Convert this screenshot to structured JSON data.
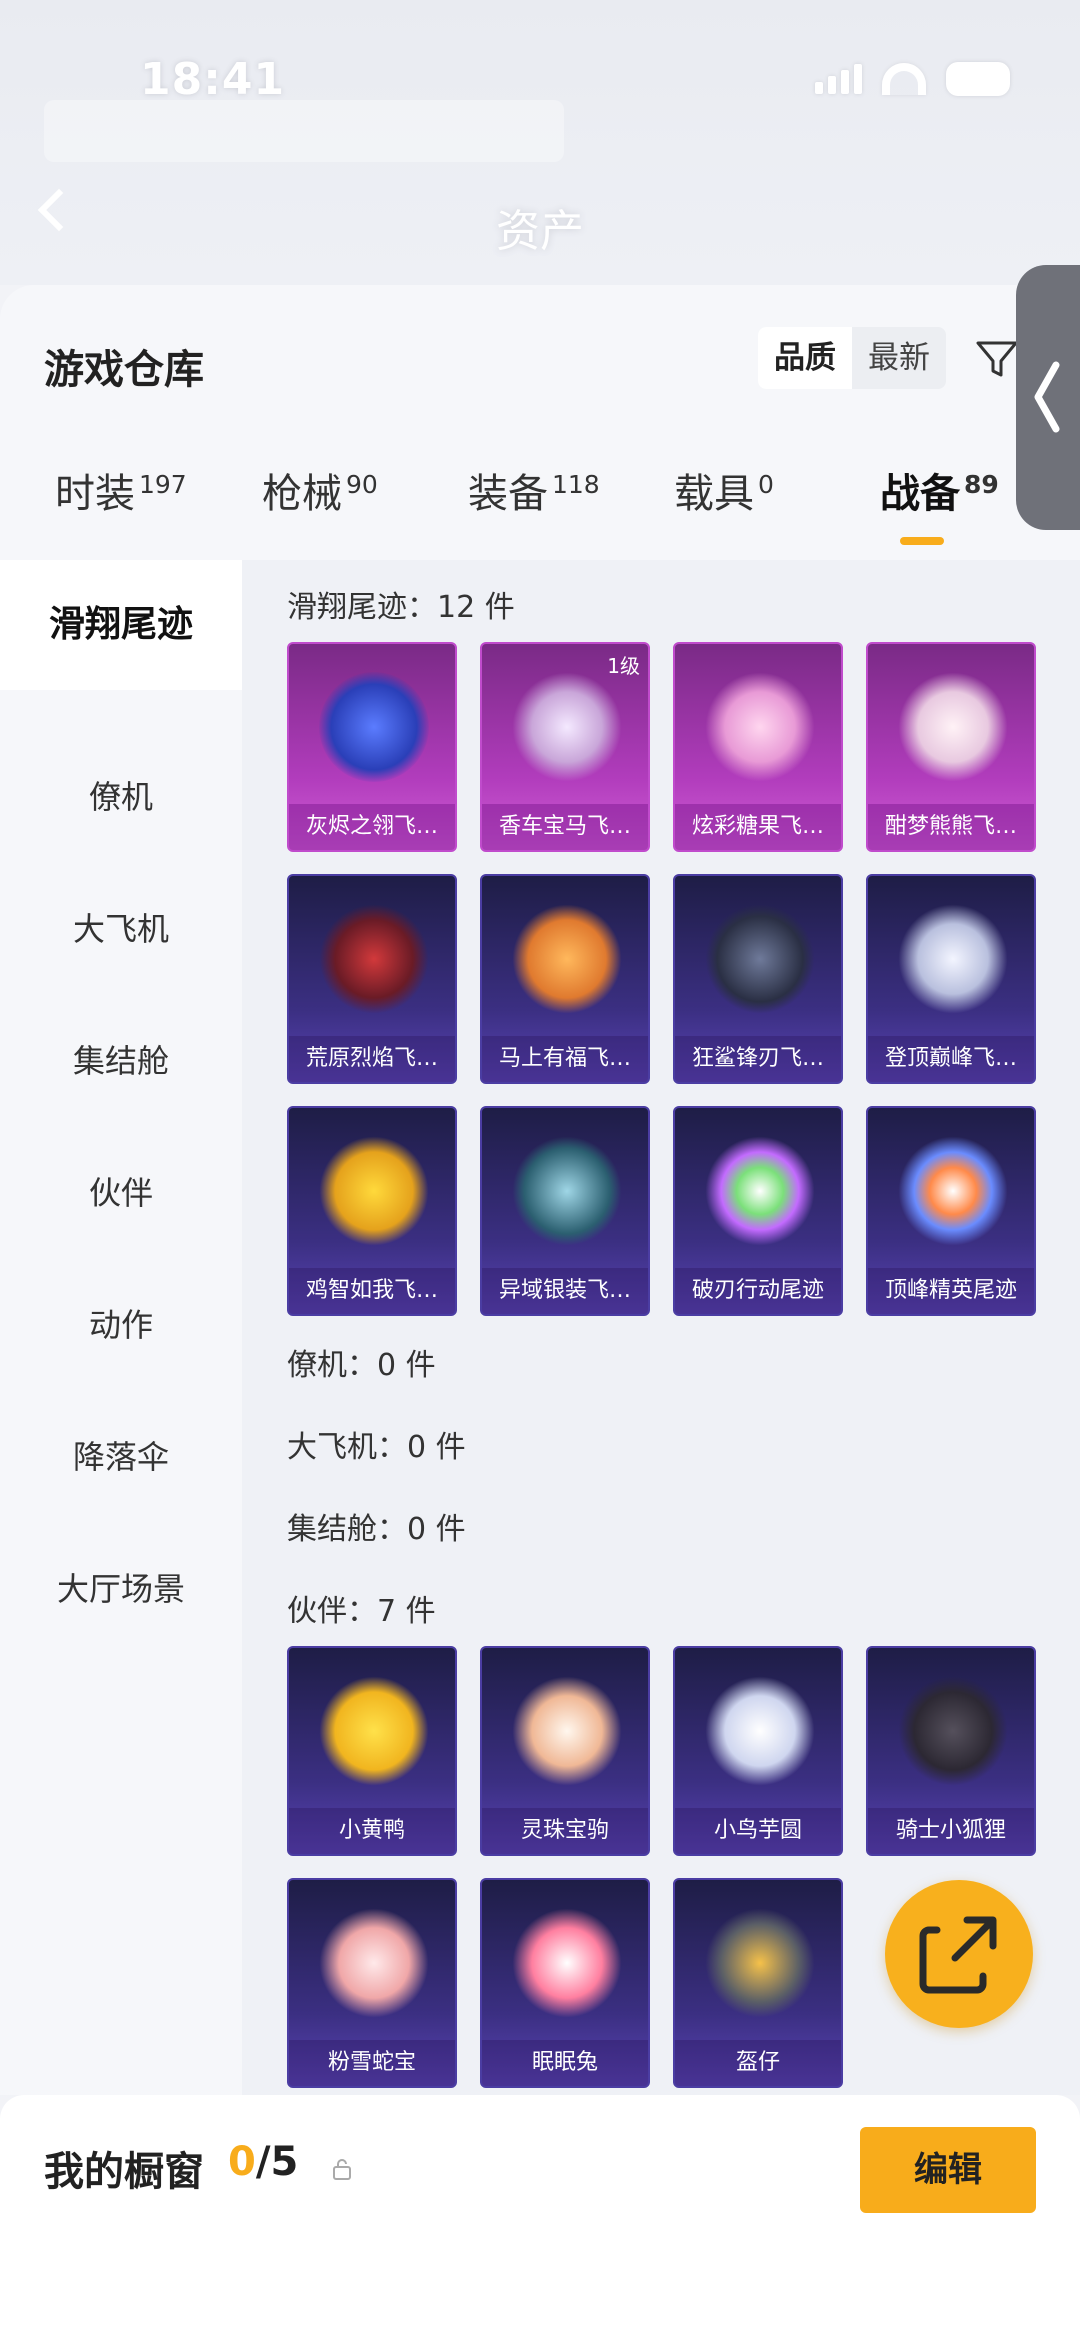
{
  "status": {
    "time": "18:41"
  },
  "nav": {
    "title": "资产"
  },
  "panel": {
    "title": "游戏仓库",
    "sort_options": [
      "品质",
      "最新"
    ]
  },
  "tabs": [
    {
      "label": "时装",
      "count": "197"
    },
    {
      "label": "枪械",
      "count": "90"
    },
    {
      "label": "装备",
      "count": "118"
    },
    {
      "label": "载具",
      "count": "0"
    },
    {
      "label": "战备",
      "count": "89"
    }
  ],
  "sidebar": {
    "items": [
      "滑翔尾迹",
      "僚机",
      "大飞机",
      "集结舱",
      "伙伴",
      "动作",
      "降落伞",
      "大厅场景"
    ]
  },
  "sections": {
    "glide": {
      "label": "滑翔尾迹：12 件"
    },
    "wingman": {
      "label": "僚机：0 件"
    },
    "plane": {
      "label": "大飞机：0 件"
    },
    "pod": {
      "label": "集结舱：0 件"
    },
    "partner": {
      "label": "伙伴：7 件"
    }
  },
  "glide_items": [
    {
      "name": "灰烬之翎飞…",
      "level": ""
    },
    {
      "name": "香车宝马飞…",
      "level": "1级"
    },
    {
      "name": "炫彩糖果飞…",
      "level": ""
    },
    {
      "name": "酣梦熊熊飞…",
      "level": ""
    },
    {
      "name": "荒原烈焰飞…",
      "level": ""
    },
    {
      "name": "马上有福飞…",
      "level": ""
    },
    {
      "name": "狂鲨锋刃飞…",
      "level": ""
    },
    {
      "name": "登顶巅峰飞…",
      "level": ""
    },
    {
      "name": "鸡智如我飞…",
      "level": ""
    },
    {
      "name": "异域银装飞…",
      "level": ""
    },
    {
      "name": "破刃行动尾迹",
      "level": ""
    },
    {
      "name": "顶峰精英尾迹",
      "level": ""
    }
  ],
  "partner_items": [
    {
      "name": "小黄鸭"
    },
    {
      "name": "灵珠宝驹"
    },
    {
      "name": "小鸟芋圆"
    },
    {
      "name": "骑士小狐狸"
    },
    {
      "name": "粉雪蛇宝"
    },
    {
      "name": "眠眠兔"
    },
    {
      "name": "盔仔"
    }
  ],
  "bottom": {
    "showcase_label": "我的橱窗",
    "showcase_current": "0",
    "showcase_total": "/5",
    "edit_label": "编辑"
  },
  "colors": {
    "accent": "#f8ac1b",
    "card_pink": "#b13cbc",
    "card_blue": "#3b2f82"
  },
  "icons": [
    "back-icon",
    "filter-icon",
    "share-icon",
    "lock-icon",
    "signal-icon",
    "wifi-icon",
    "battery-icon"
  ]
}
